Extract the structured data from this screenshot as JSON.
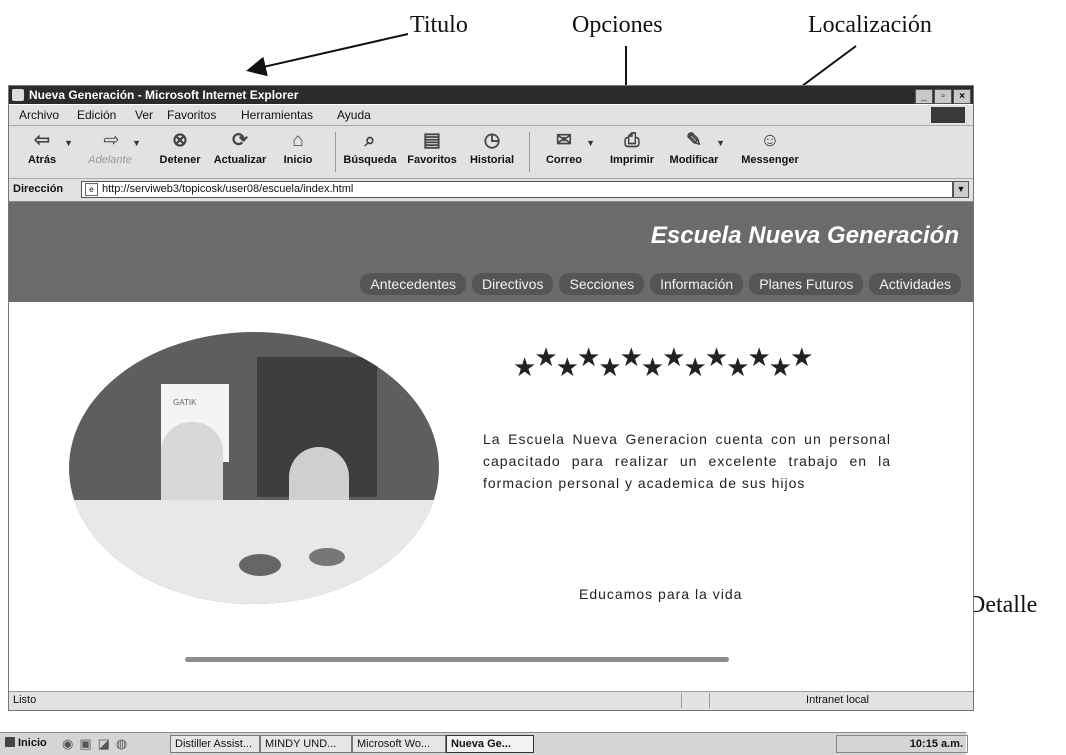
{
  "annotations": {
    "titulo": "Titulo",
    "opciones": "Opciones",
    "localizacion": "Localización",
    "detalle": "Detalle"
  },
  "window": {
    "title": "Nueva Generación - Microsoft Internet Explorer",
    "controls": [
      "_",
      "▫",
      "×"
    ]
  },
  "menu": {
    "items": [
      "Archivo",
      "Edición",
      "Ver",
      "Favoritos",
      "Herramientas",
      "Ayuda"
    ]
  },
  "toolbar": {
    "buttons": [
      "Atrás",
      "Adelante",
      "Detener",
      "Actualizar",
      "Inicio",
      "Búsqueda",
      "Favoritos",
      "Historial",
      "Correo",
      "Imprimir",
      "Modificar",
      "Messenger"
    ]
  },
  "address": {
    "label": "Dirección",
    "url": "http://serviweb3/topicosk/user08/escuela/index.html"
  },
  "page": {
    "site_title": "Escuela Nueva Generación",
    "nav": [
      "Antecedentes",
      "Directivos",
      "Secciones",
      "Información",
      "Planes Futuros",
      "Actividades"
    ],
    "photo_caption": "GATIK",
    "body_text": "La Escuela Nueva Generacion cuenta con un personal capacitado para realizar un excelente trabajo en la formacion personal y academica de sus hijos",
    "slogan": "Educamos para la vida"
  },
  "status": {
    "text": "Listo",
    "zone": "Intranet local"
  },
  "taskbar": {
    "start": "Inicio",
    "tasks": [
      "Distiller Assist...",
      "MINDY UND...",
      "Microsoft Wo...",
      "Nueva Ge..."
    ],
    "clock": "10:15 a.m."
  },
  "icons": {
    "toolbar": [
      "back-arrow-icon",
      "forward-arrow-icon",
      "stop-icon",
      "refresh-icon",
      "home-icon",
      "search-icon",
      "favorites-icon",
      "history-icon",
      "mail-icon",
      "print-icon",
      "edit-icon",
      "messenger-icon"
    ]
  }
}
